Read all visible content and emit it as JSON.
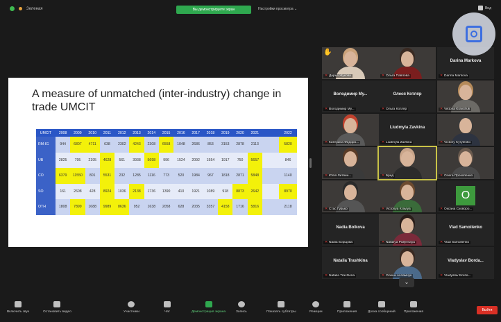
{
  "topbar": {
    "title": "Зеленая",
    "share_banner": "Вы демонстрируете экран",
    "view_options": "Настройки просмотра",
    "right_label": "Вид"
  },
  "slide": {
    "title": "A measure of unmatched (inter-industry) change in trade UMCIT",
    "table": {
      "headers": [
        "UMCIT",
        "2008",
        "2009",
        "2010",
        "2011",
        "2012",
        "2013",
        "2014",
        "2015",
        "2016",
        "2017",
        "2018",
        "2019",
        "2020",
        "2021",
        "",
        "2022"
      ],
      "rows": [
        {
          "label": "RM-IG",
          "cells": [
            "944",
            "6807",
            "4711",
            "638",
            "2302",
            "4243",
            "2308",
            "6558",
            "1048",
            "2686",
            "853",
            "3153",
            "2878",
            "2113",
            "",
            "5820"
          ]
        },
        {
          "label": "UB",
          "cells": [
            "2825",
            "795",
            "2195",
            "4628",
            "561",
            "3938",
            "5698",
            "996",
            "1524",
            "2092",
            "1554",
            "1917",
            "750",
            "5657",
            "",
            "846"
          ]
        },
        {
          "label": "CO",
          "cells": [
            "6379",
            "11550",
            "801",
            "5531",
            "232",
            "1285",
            "1116",
            "773",
            "520",
            "1984",
            "967",
            "1818",
            "2871",
            "5848",
            "",
            "1140"
          ]
        },
        {
          "label": "SO",
          "cells": [
            "161",
            "2608",
            "428",
            "8924",
            "1036",
            "2138",
            "1736",
            "1390",
            "410",
            "1921",
            "1089",
            "918",
            "8873",
            "2642",
            "",
            "8970"
          ]
        },
        {
          "label": "OTH",
          "cells": [
            "1808",
            "7899",
            "1688",
            "9989",
            "8636",
            "952",
            "1638",
            "2058",
            "628",
            "2035",
            "3357",
            "4158",
            "1716",
            "5816",
            "",
            "2118"
          ]
        }
      ],
      "highlighted": [
        [
          false,
          true,
          true,
          false,
          false,
          true,
          false,
          true,
          false,
          false,
          false,
          false,
          false,
          false,
          false,
          true
        ],
        [
          false,
          false,
          false,
          true,
          false,
          false,
          true,
          false,
          false,
          false,
          false,
          false,
          false,
          true,
          false,
          false
        ],
        [
          true,
          true,
          false,
          true,
          false,
          false,
          false,
          false,
          false,
          false,
          false,
          false,
          false,
          true,
          false,
          false
        ],
        [
          false,
          false,
          false,
          true,
          false,
          true,
          false,
          false,
          false,
          false,
          false,
          false,
          true,
          true,
          false,
          true
        ],
        [
          false,
          true,
          false,
          true,
          true,
          false,
          false,
          false,
          false,
          false,
          false,
          true,
          false,
          true,
          false,
          false
        ]
      ]
    }
  },
  "participants": [
    {
      "caption": "Дарья Жукова",
      "center_name": "",
      "type": "photo",
      "hair": "#caa27a",
      "shirt": "#d8c9b8"
    },
    {
      "caption": "Ольга Павлова",
      "center_name": "",
      "type": "photo",
      "hair": "#3a2a22",
      "shirt": "#7a1e1e"
    },
    {
      "caption": "Darina Markova",
      "center_name": "Darina Markova",
      "type": "name"
    },
    {
      "caption": "Володимир Му...",
      "center_name": "Володимир Му...",
      "type": "name"
    },
    {
      "caption": "Ольга Котляр",
      "center_name": "Олеся Котляр",
      "type": "name"
    },
    {
      "caption": "Viktoria Kravchuk",
      "center_name": "",
      "type": "photo",
      "hair": "#b58a5a",
      "shirt": "#6c6a66"
    },
    {
      "caption": "Катерина Федоро...",
      "center_name": "",
      "type": "photo",
      "hair": "#c2422e",
      "shirt": "#5a5a5a"
    },
    {
      "caption": "Liudmyla Zavkina",
      "center_name": "Liudmyla Zavkina",
      "type": "name"
    },
    {
      "caption": "Victoriy Kyrylenko",
      "center_name": "",
      "type": "photo",
      "hair": "#3b3b3b",
      "shirt": "#2d3340"
    },
    {
      "caption": "Юлія Литвин...",
      "center_name": "",
      "type": "photo",
      "hair": "#5a3b26",
      "shirt": "#3a3a3a"
    },
    {
      "caption": "Бред",
      "center_name": "",
      "type": "photo",
      "hair": "#c9a58a",
      "shirt": "#2b2b2b",
      "active": true
    },
    {
      "caption": "Олега Прокопенко",
      "center_name": "",
      "type": "photo",
      "hair": "#6a5a4e",
      "shirt": "#4a4a4a"
    },
    {
      "caption": "Стас Гурько",
      "center_name": "",
      "type": "photo",
      "hair": "#2a2a2a",
      "shirt": "#555555"
    },
    {
      "caption": "Victoriya Kraviya",
      "center_name": "",
      "type": "photo",
      "hair": "#6c4a2f",
      "shirt": "#3a6b3a"
    },
    {
      "caption": "Оксана Сковоро...",
      "center_name": "",
      "type": "letter",
      "letter": "O"
    },
    {
      "caption": "Nadia Борщова",
      "center_name": "Nadia Bolkova",
      "type": "name"
    },
    {
      "caption": "Nataliya Pidlyvnaya",
      "center_name": "",
      "type": "photo",
      "hair": "#2a1e1a",
      "shirt": "#7a2a3a"
    },
    {
      "caption": "Vlad Samoilenko",
      "center_name": "Vlad Samoilenko",
      "type": "name"
    },
    {
      "caption": "Natalia Trachkina",
      "center_name": "Natalia Trashkina",
      "type": "name"
    },
    {
      "caption": "Олена Ахламчук",
      "center_name": "",
      "type": "photo",
      "hair": "#3a2a22",
      "shirt": "#4b6a8a"
    },
    {
      "caption": "Vladyslav Borda...",
      "center_name": "Vladyslav Borda...",
      "type": "name"
    }
  ],
  "toolbar": {
    "buttons": [
      {
        "label": "Включить звук",
        "icon": "mic-off-icon"
      },
      {
        "label": "Остановить видео",
        "icon": "video-icon"
      },
      {
        "label": "Участники",
        "icon": "participants-icon"
      },
      {
        "label": "Чат",
        "icon": "chat-icon"
      },
      {
        "label": "Демонстрация экрана",
        "icon": "share-screen-icon"
      },
      {
        "label": "Запись",
        "icon": "record-icon"
      },
      {
        "label": "Показать субтитры",
        "icon": "captions-icon"
      },
      {
        "label": "Реакции",
        "icon": "reactions-icon"
      },
      {
        "label": "Приложения",
        "icon": "apps-icon"
      },
      {
        "label": "Доска сообщений",
        "icon": "whiteboard-icon"
      },
      {
        "label": "Приложения",
        "icon": "notes-icon"
      }
    ],
    "leave_label": "Выйти"
  },
  "colors": {
    "share_green": "#2fa84f",
    "leave_red": "#d93025",
    "table_header": "#2a56c6",
    "highlight_yellow": "#f3f10a"
  }
}
